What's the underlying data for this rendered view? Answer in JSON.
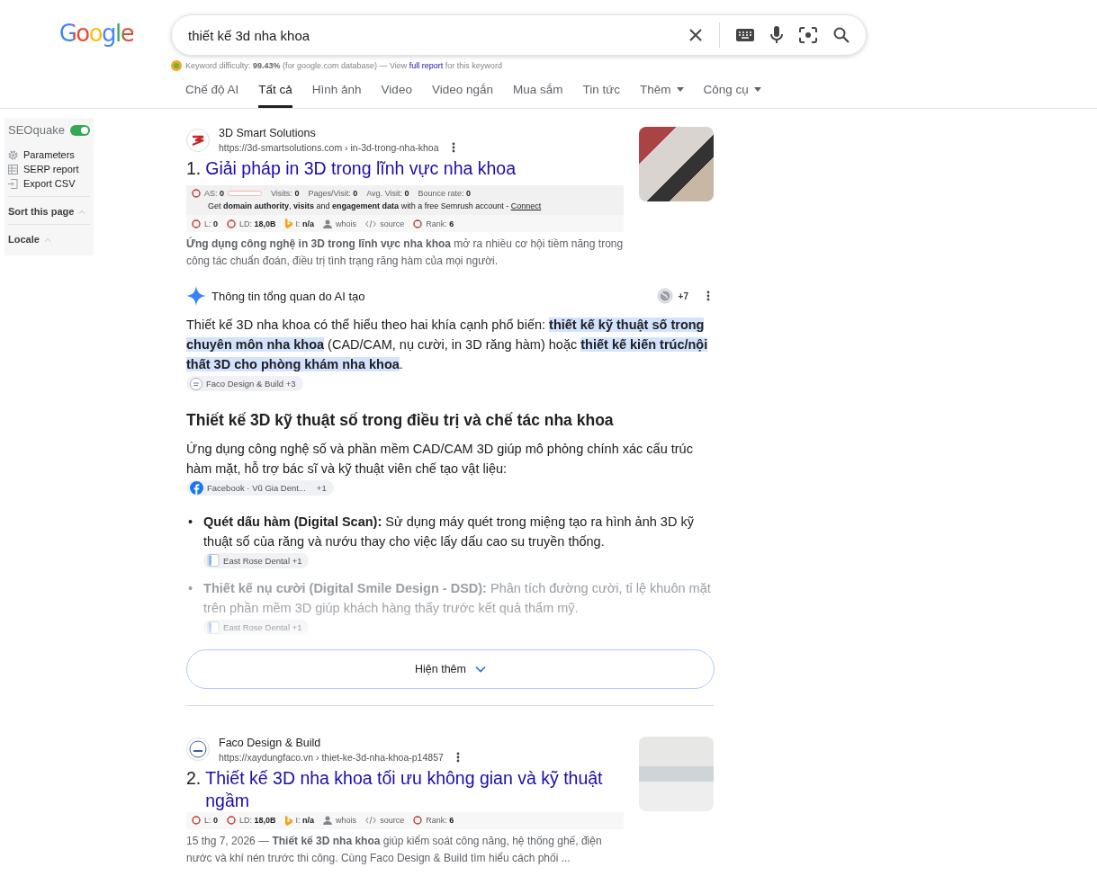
{
  "logo": {
    "text": "Google"
  },
  "search": {
    "value": "thiết kế 3d nha khoa"
  },
  "keyword_bar": {
    "label": "Keyword difficulty:",
    "value": "99.43%",
    "note": "(for google.com database) — View",
    "link": "full report",
    "suffix": "for this keyword"
  },
  "tabs": [
    {
      "label": "Chế độ AI",
      "selected": false,
      "dropdown": false
    },
    {
      "label": "Tất cả",
      "selected": true,
      "dropdown": false
    },
    {
      "label": "Hình ảnh",
      "selected": false,
      "dropdown": false
    },
    {
      "label": "Video",
      "selected": false,
      "dropdown": false
    },
    {
      "label": "Video ngắn",
      "selected": false,
      "dropdown": false
    },
    {
      "label": "Mua sắm",
      "selected": false,
      "dropdown": false
    },
    {
      "label": "Tin tức",
      "selected": false,
      "dropdown": false
    },
    {
      "label": "Thêm",
      "selected": false,
      "dropdown": true
    },
    {
      "label": "Công cụ",
      "selected": false,
      "dropdown": true
    }
  ],
  "sidebar": {
    "title": "SEOquake",
    "on": true,
    "items": [
      {
        "label": "Parameters",
        "kind": "gear"
      },
      {
        "label": "SERP report",
        "kind": "table"
      },
      {
        "label": "Export CSV",
        "kind": "export"
      }
    ],
    "sections": [
      {
        "label": "Sort this page",
        "expanded": true
      },
      {
        "label": "Locale",
        "expanded": true
      }
    ]
  },
  "results": [
    {
      "site": "3D Smart Solutions",
      "url": "https://3d-smartsolutions.com › in-3d-trong-nha-khoa",
      "number": "1.",
      "title": "Giải pháp in 3D trong lĩnh vực nha khoa",
      "traffic": [
        {
          "label": "AS:",
          "value": "0",
          "kind": "bar",
          "level": 0
        },
        {
          "label": "Visits:",
          "value": "0"
        },
        {
          "label": "Pages/Visit:",
          "value": "0"
        },
        {
          "label": "Avg. Visit:",
          "value": "0"
        },
        {
          "label": "Bounce rate:",
          "value": "0"
        }
      ],
      "promo": "Get **domain authority**, **visits** and **engagement data** with a free Semrush account -",
      "promo_link": "Connect",
      "metrics": [
        {
          "label": "L:",
          "value": "0",
          "kind": "ring"
        },
        {
          "label": "LD:",
          "value": "18,0B",
          "kind": "ring"
        },
        {
          "label": "I:",
          "value": "n/a",
          "kind": "bing"
        },
        {
          "label": "whois",
          "kind": "person"
        },
        {
          "label": "source",
          "kind": "code"
        },
        {
          "label": "Rank:",
          "value": "6",
          "kind": "ring"
        }
      ],
      "snippet": "**Ứng dụng công nghệ in 3D trong lĩnh vực nha khoa** mở ra nhiều cơ hội tiềm năng trong công tác chuẩn đoán, điều trị tình trạng răng hàm của mọi người."
    },
    {
      "site": "Faco Design & Build",
      "url": "https://xaydungfaco.vn › thiet-ke-3d-nha-khoa-p14857",
      "number": "2.",
      "title": "Thiết kế 3D nha khoa tối ưu không gian và kỹ thuật ngầm",
      "metrics": [
        {
          "label": "L:",
          "value": "0",
          "kind": "ring"
        },
        {
          "label": "LD:",
          "value": "18,0B",
          "kind": "ring"
        },
        {
          "label": "I:",
          "value": "n/a",
          "kind": "bing"
        },
        {
          "label": "whois",
          "kind": "person"
        },
        {
          "label": "source",
          "kind": "code"
        },
        {
          "label": "Rank:",
          "value": "6",
          "kind": "ring"
        }
      ],
      "snippet": "15 thg 7, 2026 — **Thiết kế 3D nha khoa** giúp kiểm soát công năng, hệ thống ghế, điện nước và khí nén trước thi công. Cùng Faco Design & Build tìm hiểu cách phối ..."
    }
  ],
  "ai_overview": {
    "title": "Thông tin tổng quan do AI tạo",
    "sources_count": "+7",
    "intro": "Thiết kế 3D nha khoa có thể hiểu theo hai khía cạnh phổ biến: **thiết kế kỹ thuật số trong chuyên môn nha khoa** (CAD/CAM, nụ cười, in 3D răng hàm) hoặc **thiết kế kiến trúc/nội thất 3D cho phòng khám nha khoa**.",
    "intro_chip": {
      "label": "Faco Design & Build +3",
      "kind": "web"
    },
    "heading": "Thiết kế 3D kỹ thuật số trong điều trị và chế tác nha khoa",
    "paragraph": "Ứng dụng công nghệ số và phần mềm CAD/CAM 3D giúp mô phỏng chính xác cấu trúc hàm mặt, hỗ trợ bác sĩ và kỹ thuật viên chế tạo vật liệu:",
    "paragraph_chip": {
      "label": "Facebook · Vũ Gia Dent...",
      "count": "+1",
      "kind": "facebook"
    },
    "bullets": [
      {
        "marker": "•",
        "text": "**Quét dấu hàm (Digital Scan):** Sử dụng máy quét trong miệng tạo ra hình ảnh 3D kỹ thuật số của răng và nướu thay cho việc lấy dấu cao su truyền thống.",
        "chip": {
          "label": "East Rose Dental +1",
          "kind": "doc"
        },
        "faded": false
      },
      {
        "marker": "•",
        "text": "**Thiết kế nụ cười (Digital Smile Design - DSD):** Phân tích đường cười, tỉ lệ khuôn mặt trên phần mềm 3D giúp khách hàng thấy trước kết quả thẩm mỹ.",
        "chip": {
          "label": "East Rose Dental +1",
          "kind": "doc"
        },
        "faded": true
      }
    ],
    "show_more": "Hiện thêm"
  }
}
